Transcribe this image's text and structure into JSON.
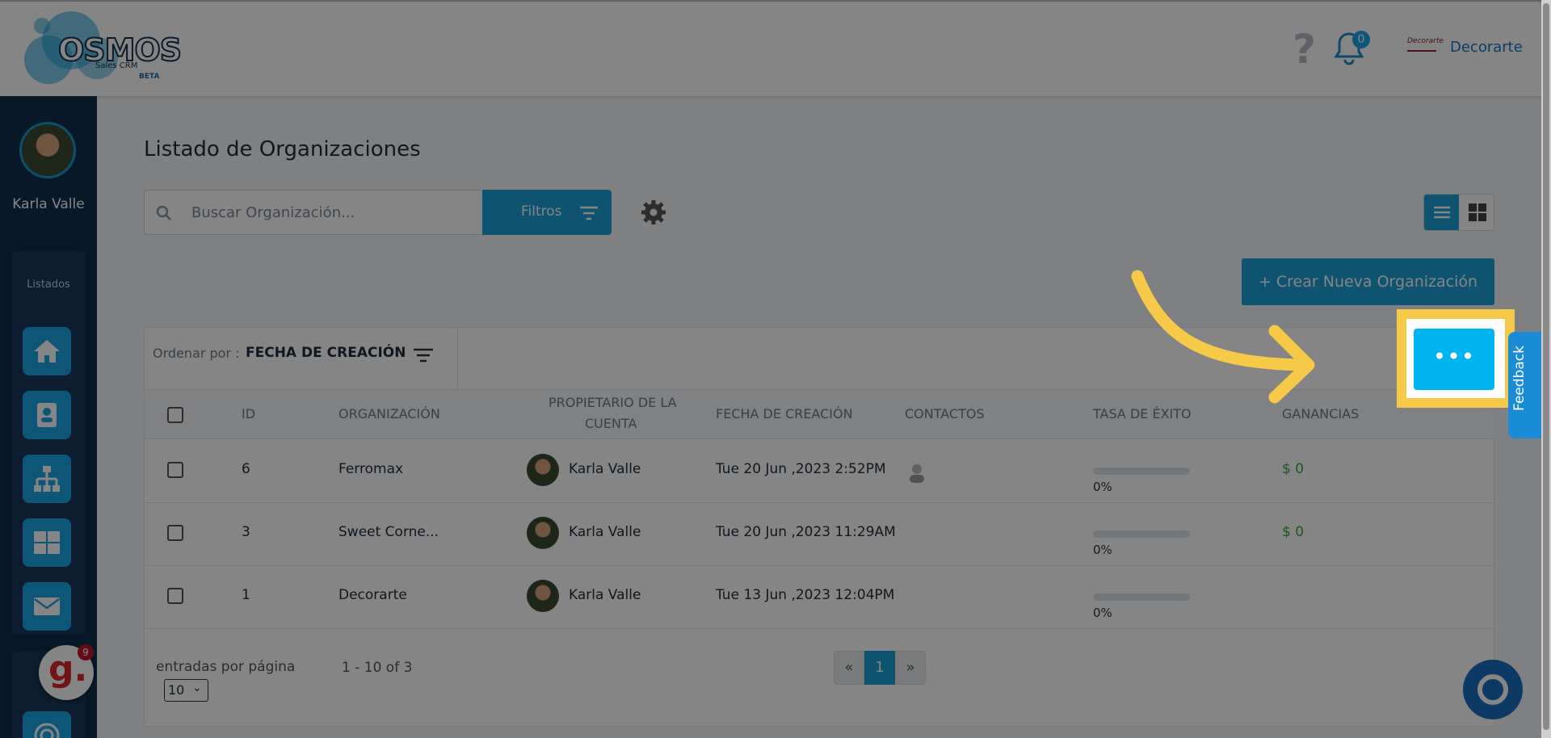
{
  "header": {
    "logo_text": "OSMOS",
    "logo_sub": "Sales CRM",
    "logo_beta": "BETA",
    "help_icon": "question-icon",
    "notifications_count": "0",
    "company_name": "Decorarte"
  },
  "sidebar": {
    "user_name": "Karla Valle",
    "section_label": "Listados",
    "items": [
      {
        "icon": "home-icon"
      },
      {
        "icon": "contact-card-icon"
      },
      {
        "icon": "org-chart-icon"
      },
      {
        "icon": "grid-icon"
      },
      {
        "icon": "envelope-icon"
      }
    ],
    "badge_letter": "g.",
    "badge_count": "9"
  },
  "main": {
    "title": "Listado de Organizaciones",
    "search_placeholder": "Buscar Organización...",
    "filters_label": "Filtros",
    "create_button": "+ Crear Nueva Organización",
    "sort_prefix": "Ordenar por :",
    "sort_value": "FECHA DE CREACIÓN",
    "columns": {
      "id": "ID",
      "organization": "ORGANIZACIÓN",
      "owner_line1": "PROPIETARIO DE LA",
      "owner_line2": "CUENTA",
      "created": "FECHA DE CREACIÓN",
      "contacts": "CONTACTOS",
      "success_rate": "TASA DE ÉXITO",
      "earnings": "GANANCIAS"
    },
    "rows": [
      {
        "id": "6",
        "organization": "Ferromax",
        "owner": "Karla Valle",
        "created": "Tue 20 Jun ,2023 2:52PM",
        "rate": "0%",
        "rate_value": 0,
        "earnings": "$ 0"
      },
      {
        "id": "3",
        "organization": "Sweet Corne...",
        "owner": "Karla Valle",
        "created": "Tue 20 Jun ,2023 11:29AM",
        "rate": "0%",
        "rate_value": 0,
        "earnings": "$ 0"
      },
      {
        "id": "1",
        "organization": "Decorarte",
        "owner": "Karla Valle",
        "created": "Tue 13 Jun ,2023 12:04PM",
        "rate": "0%",
        "rate_value": 0,
        "earnings": ""
      }
    ],
    "pagination": {
      "per_page_label": "entradas por página",
      "per_page_value": "10",
      "range": "1 - 10 of 3",
      "prev": "«",
      "current": "1",
      "next": "»"
    },
    "more_button": "•••"
  },
  "feedback_label": "Feedback",
  "colors": {
    "accent": "#1ba1d8",
    "sidebar": "#0e2f4e",
    "highlight": "#f7c948",
    "earnings_green": "#3aa33a"
  }
}
